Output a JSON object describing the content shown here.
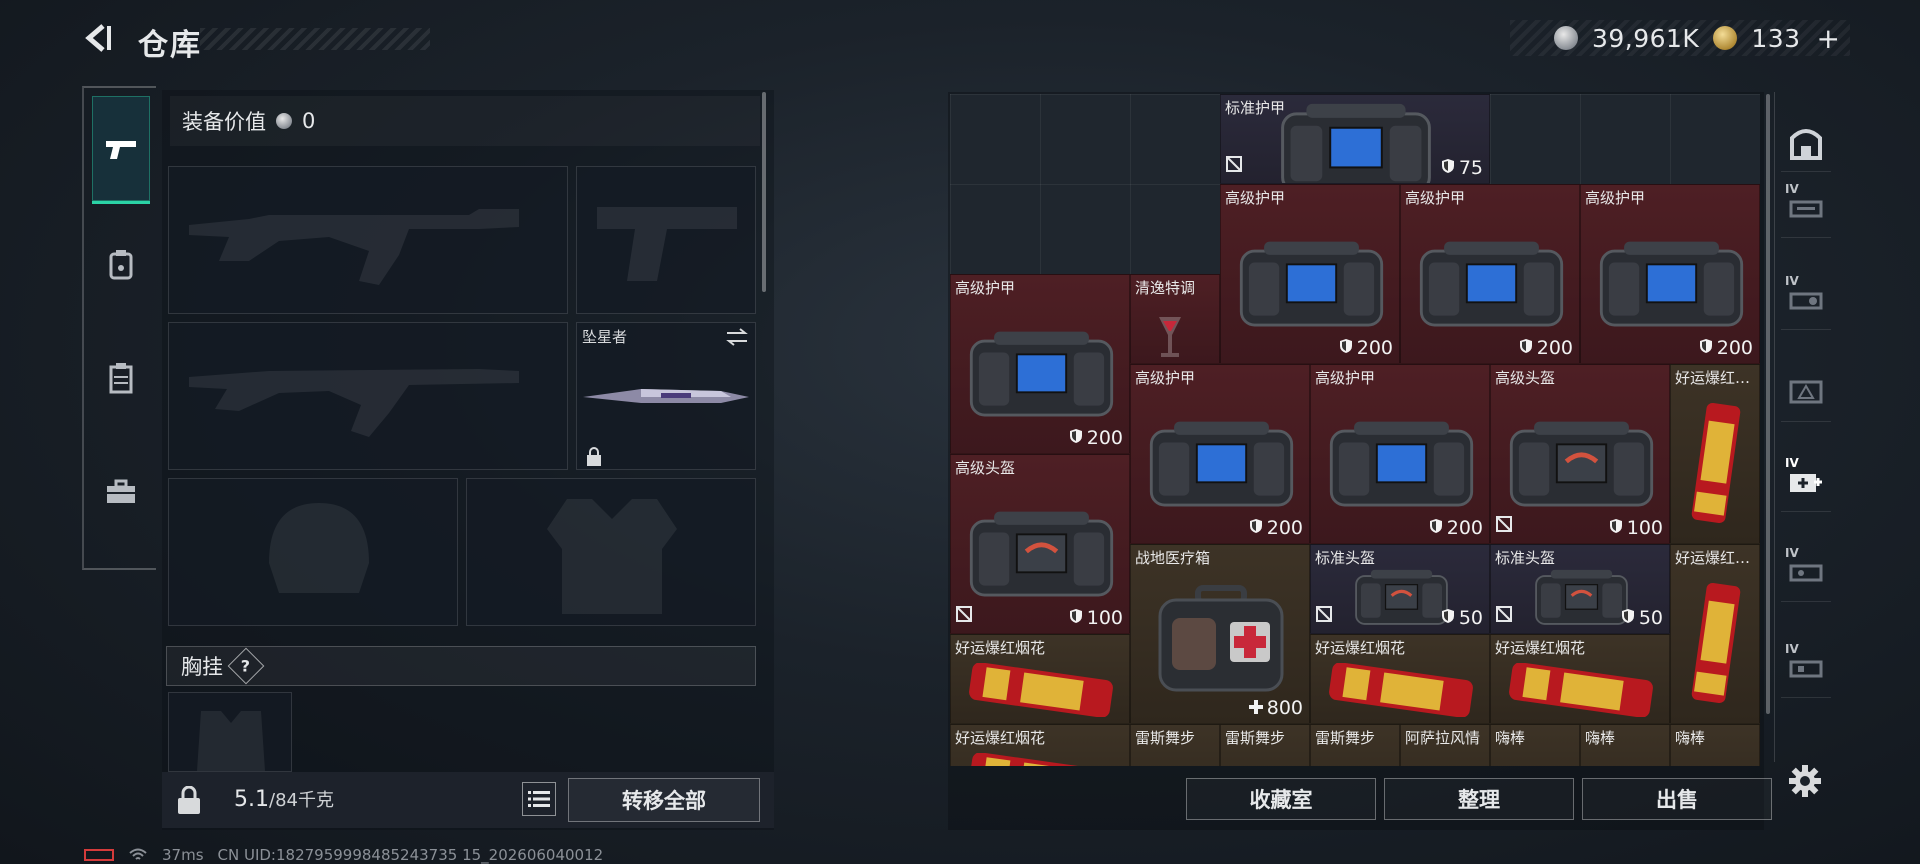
{
  "header": {
    "title": "仓库",
    "currency_silver": "39,961K",
    "currency_gold": "133",
    "plus": "+"
  },
  "equipment": {
    "header_label": "装备价值",
    "header_value": "0",
    "melee_slot_name": "坠星者",
    "chest_label": "胸挂",
    "help": "?"
  },
  "bottom_left": {
    "weight": "5.1",
    "weight_max": "/84千克",
    "transfer_all": "转移全部"
  },
  "status": {
    "ping": "37ms",
    "uid": "CN UID:1827959998485243735 15_202606040012"
  },
  "inventory": {
    "items": [
      {
        "name": "标准护甲",
        "value": "75",
        "icon": "shield-icon",
        "flag": true
      },
      {
        "name": "高级护甲",
        "value": "200",
        "icon": "shield-icon"
      },
      {
        "name": "高级护甲",
        "value": "200",
        "icon": "shield-icon"
      },
      {
        "name": "高级护甲",
        "value": "200",
        "icon": "shield-icon"
      },
      {
        "name": "高级护甲",
        "value": "200",
        "icon": "shield-icon"
      },
      {
        "name": "清逸特调",
        "value": "",
        "icon": ""
      },
      {
        "name": "高级护甲",
        "value": "200",
        "icon": "shield-icon"
      },
      {
        "name": "高级护甲",
        "value": "200",
        "icon": "shield-icon"
      },
      {
        "name": "高级头盔",
        "value": "100",
        "icon": "shield-icon",
        "flag": true
      },
      {
        "name": "好运爆红…",
        "value": "",
        "icon": ""
      },
      {
        "name": "高级头盔",
        "value": "100",
        "icon": "shield-icon",
        "flag": true
      },
      {
        "name": "战地医疗箱",
        "value": "800",
        "icon": "cross-icon"
      },
      {
        "name": "标准头盔",
        "value": "50",
        "icon": "shield-icon",
        "flag": true
      },
      {
        "name": "标准头盔",
        "value": "50",
        "icon": "shield-icon",
        "flag": true
      },
      {
        "name": "好运爆红…",
        "value": "",
        "icon": ""
      },
      {
        "name": "好运爆红烟花",
        "value": "",
        "icon": ""
      },
      {
        "name": "好运爆红烟花",
        "value": "",
        "icon": ""
      },
      {
        "name": "好运爆红烟花",
        "value": "",
        "icon": ""
      },
      {
        "name": "好运爆红烟花",
        "value": "",
        "icon": ""
      },
      {
        "name": "雷斯舞步",
        "value": "",
        "icon": ""
      },
      {
        "name": "雷斯舞步",
        "value": "",
        "icon": ""
      },
      {
        "name": "雷斯舞步",
        "value": "",
        "icon": ""
      },
      {
        "name": "阿萨拉风情",
        "value": "",
        "icon": ""
      },
      {
        "name": "嗨棒",
        "value": "",
        "icon": ""
      },
      {
        "name": "嗨棒",
        "value": "",
        "icon": ""
      },
      {
        "name": "嗨棒",
        "value": "",
        "icon": ""
      }
    ]
  },
  "right_rail": {
    "tier_badge": "IV"
  },
  "buttons": {
    "collection": "收藏室",
    "organize": "整理",
    "sell": "出售"
  },
  "colors": {
    "accent": "#2bd3a6",
    "rarity_red": "#4e1f24",
    "rarity_purple": "#2b2a3b",
    "rarity_gold": "#3d3326"
  }
}
